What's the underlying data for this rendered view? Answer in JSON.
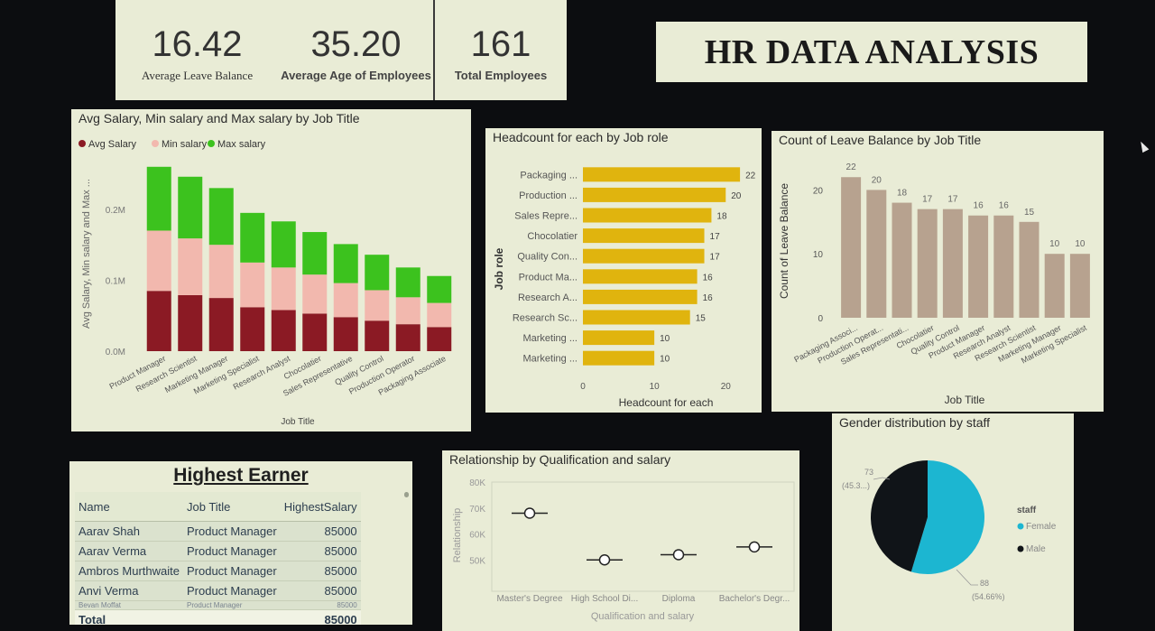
{
  "kpis": [
    {
      "value": "16.42",
      "label": "Average Leave Balance"
    },
    {
      "value": "35.20",
      "label": "Average Age of Employees"
    },
    {
      "value": "161",
      "label": "Total Employees"
    }
  ],
  "dashboard_title": "HR DATA ANALYSIS",
  "salary_table": {
    "title": "Highest Earner",
    "columns": [
      "Name",
      "Job Title",
      "HighestSalary"
    ],
    "rows": [
      {
        "name": "Aarav Shah",
        "job": "Product Manager",
        "salary": "85000"
      },
      {
        "name": "Aarav Verma",
        "job": "Product Manager",
        "salary": "85000"
      },
      {
        "name": "Ambros Murthwaite",
        "job": "Product Manager",
        "salary": "85000"
      },
      {
        "name": "Anvi Verma",
        "job": "Product Manager",
        "salary": "85000"
      },
      {
        "name": "Bevan Moffat",
        "job": "Product Manager",
        "salary": "85000"
      }
    ],
    "total_label": "Total",
    "total_value": "85000"
  },
  "colors": {
    "min_salary": "#f2b8ae",
    "avg_salary": "#8b1a24",
    "max_salary": "#3cc21e",
    "headcount": "#e0b40e",
    "leave": "#b7a28f",
    "female": "#1cb6d1",
    "male": "#101418"
  },
  "chart_data": [
    {
      "id": "salary",
      "type": "bar",
      "stacked": true,
      "title": "Avg Salary, Min salary and Max salary by Job Title",
      "xlabel": "Job Title",
      "ylabel": "Avg Salary, Min salary and Max ...",
      "legend_position": "top-left",
      "categories": [
        "Product Manager",
        "Research Scientist",
        "Marketing Manager",
        "Marketing Specialist",
        "Research Analyst",
        "Chocolatier",
        "Sales Representative",
        "Quality Control",
        "Production Operator",
        "Packaging Associate"
      ],
      "series": [
        {
          "name": "Avg Salary",
          "values": [
            85000,
            79000,
            75000,
            62000,
            58000,
            53000,
            48000,
            43000,
            38000,
            34000
          ]
        },
        {
          "name": "Min salary",
          "values": [
            85000,
            80000,
            75000,
            63000,
            60000,
            55000,
            48000,
            43000,
            38000,
            34000
          ]
        },
        {
          "name": "Max salary",
          "values": [
            90000,
            87000,
            80000,
            70000,
            65000,
            60000,
            55000,
            50000,
            42000,
            38000
          ]
        }
      ],
      "yticks": [
        "0.0M",
        "0.1M",
        "0.2M"
      ],
      "ylim": [
        0,
        275000
      ]
    },
    {
      "id": "headcount",
      "type": "bar",
      "orientation": "horizontal",
      "title": "Headcount for each by Job role",
      "xlabel": "Headcount for each",
      "ylabel": "Job role",
      "categories": [
        "Packaging ...",
        "Production ...",
        "Sales Repre...",
        "Chocolatier",
        "Quality Con...",
        "Product Ma...",
        "Research A...",
        "Research Sc...",
        "Marketing ...",
        "Marketing ..."
      ],
      "values": [
        22,
        20,
        18,
        17,
        17,
        16,
        16,
        15,
        10,
        10
      ],
      "xticks": [
        0,
        10,
        20
      ],
      "xlim": [
        0,
        23
      ]
    },
    {
      "id": "leave",
      "type": "bar",
      "title": "Count of Leave Balance by Job Title",
      "xlabel": "Job Title",
      "ylabel": "Count of Leave Balance",
      "categories": [
        "Packaging Associ...",
        "Production Operat...",
        "Sales Representati...",
        "Chocolatier",
        "Quality Control",
        "Product Manager",
        "Research Analyst",
        "Research Scientist",
        "Marketing Manager",
        "Marketing Specialist"
      ],
      "values": [
        22,
        20,
        18,
        17,
        17,
        16,
        16,
        15,
        10,
        10
      ],
      "yticks": [
        0,
        10,
        20
      ],
      "ylim": [
        0,
        25
      ]
    },
    {
      "id": "relationship",
      "type": "scatter",
      "title": "Relationship by Qualification and salary",
      "xlabel": "Qualification and salary",
      "ylabel": "Relationship",
      "categories": [
        "Master's Degree",
        "High School Di...",
        "Diploma",
        "Bachelor's Degr..."
      ],
      "values": [
        68000,
        50000,
        52000,
        55000
      ],
      "yticks": [
        "50K",
        "60K",
        "70K",
        "80K"
      ],
      "ylim": [
        40000,
        80000
      ]
    },
    {
      "id": "gender",
      "type": "pie",
      "title": "Gender distribution by staff",
      "legend_title": "staff",
      "legend_position": "right",
      "slices": [
        {
          "name": "Female",
          "value": 88,
          "label_line1": "88",
          "label_line2": "(54.66%)"
        },
        {
          "name": "Male",
          "value": 73,
          "label_line1": "73",
          "label_line2": "(45.3...)"
        }
      ]
    }
  ]
}
